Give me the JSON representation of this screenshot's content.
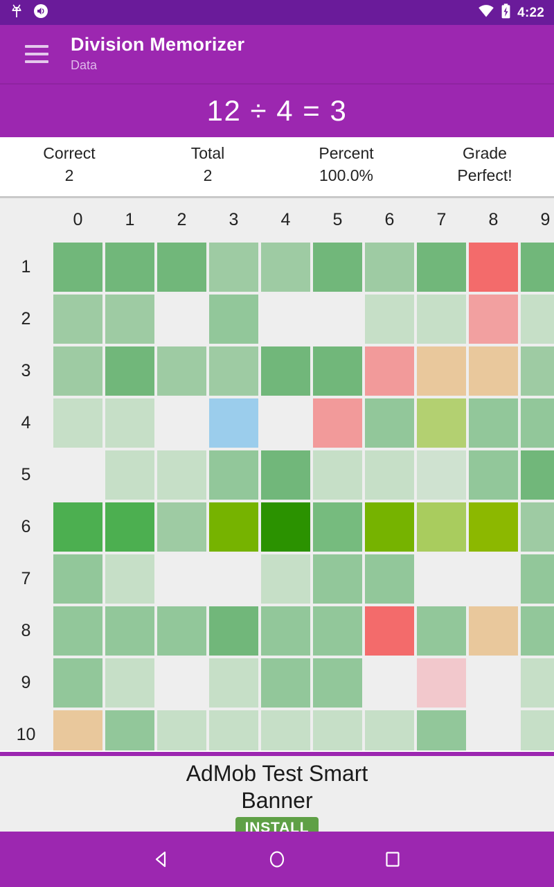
{
  "status_bar": {
    "icons_left": [
      "android-bug-icon",
      "volume-icon"
    ],
    "icons_right": [
      "wifi-icon",
      "battery-charging-icon"
    ],
    "time": "4:22",
    "background": "#6a1b9a"
  },
  "app_bar": {
    "menu_icon": "hamburger-menu-icon",
    "title": "Division Memorizer",
    "subtitle": "Data",
    "background": "#9c27b0"
  },
  "equation_bar": {
    "text": "12 ÷ 4 = 3"
  },
  "stats": {
    "columns": [
      {
        "label": "Correct",
        "value": "2"
      },
      {
        "label": "Total",
        "value": "2"
      },
      {
        "label": "Percent",
        "value": "100.0%"
      },
      {
        "label": "Grade",
        "value": "Perfect!"
      }
    ]
  },
  "chart_data": {
    "type": "heatmap",
    "title": "Division Memorizer Data",
    "xlabel": "",
    "ylabel": "",
    "col_headers": [
      "0",
      "1",
      "2",
      "3",
      "4",
      "5",
      "6",
      "7",
      "8",
      "9"
    ],
    "row_headers": [
      "1",
      "2",
      "3",
      "4",
      "5",
      "6",
      "7",
      "8",
      "9",
      "10"
    ],
    "legend": "none",
    "grid": true,
    "background": "#eeeeee",
    "colors": [
      [
        "#71b77a",
        "#71b77a",
        "#71b77a",
        "#9ecba3",
        "#9ecba3",
        "#71b77a",
        "#9ecba3",
        "#71b77a",
        "#f36b6b",
        "#71b77a"
      ],
      [
        "#9ecba3",
        "#9ecba3",
        "#eeeeee",
        "#92c79a",
        "#eeeeee",
        "#eeeeee",
        "#c6dfc7",
        "#c6dfc7",
        "#f2a0a0",
        "#c6dfc7"
      ],
      [
        "#9ecba3",
        "#71b77a",
        "#9ecba3",
        "#9ecba3",
        "#71b77a",
        "#71b77a",
        "#f29a9a",
        "#e9c89c",
        "#e9c89c",
        "#9ecba3"
      ],
      [
        "#c6dfc7",
        "#c6dfc7",
        "#eeeeee",
        "#9bcdec",
        "#eeeeee",
        "#f29a9a",
        "#92c79a",
        "#b3d071",
        "#92c79a",
        "#92c79a"
      ],
      [
        "#eeeeee",
        "#c6dfc7",
        "#c6dfc7",
        "#92c79a",
        "#71b77a",
        "#c6dfc7",
        "#c6dfc7",
        "#cfe2d0",
        "#92c79a",
        "#71b77a"
      ],
      [
        "#4caf50",
        "#4caf50",
        "#9ecba3",
        "#76b300",
        "#2b9200",
        "#76bb7e",
        "#76b300",
        "#a9cc5e",
        "#8cb800",
        "#9ecba3"
      ],
      [
        "#92c79a",
        "#c6dfc7",
        "#eeeeee",
        "#eeeeee",
        "#c6dfc7",
        "#92c79a",
        "#92c79a",
        "#eeeeee",
        "#eeeeee",
        "#92c79a"
      ],
      [
        "#92c79a",
        "#92c79a",
        "#92c79a",
        "#71b77a",
        "#92c79a",
        "#92c79a",
        "#f36b6b",
        "#92c79a",
        "#e9c89c",
        "#92c79a"
      ],
      [
        "#92c79a",
        "#c6dfc7",
        "#eeeeee",
        "#c6dfc7",
        "#92c79a",
        "#92c79a",
        "#eeeeee",
        "#f2c8cc",
        "#eeeeee",
        "#c6dfc7"
      ],
      [
        "#e9c89c",
        "#92c79a",
        "#c6dfc7",
        "#c6dfc7",
        "#c6dfc7",
        "#c6dfc7",
        "#c6dfc7",
        "#92c79a",
        "#eeeeee",
        "#c6dfc7"
      ]
    ]
  },
  "ad": {
    "title": "AdMob Test Smart Banner",
    "install_label": "INSTALL",
    "install_color": "#5fa046"
  },
  "nav_bar": {
    "buttons": [
      "back-triangle-icon",
      "home-circle-icon",
      "recents-square-icon"
    ],
    "background": "#9c27b0"
  }
}
